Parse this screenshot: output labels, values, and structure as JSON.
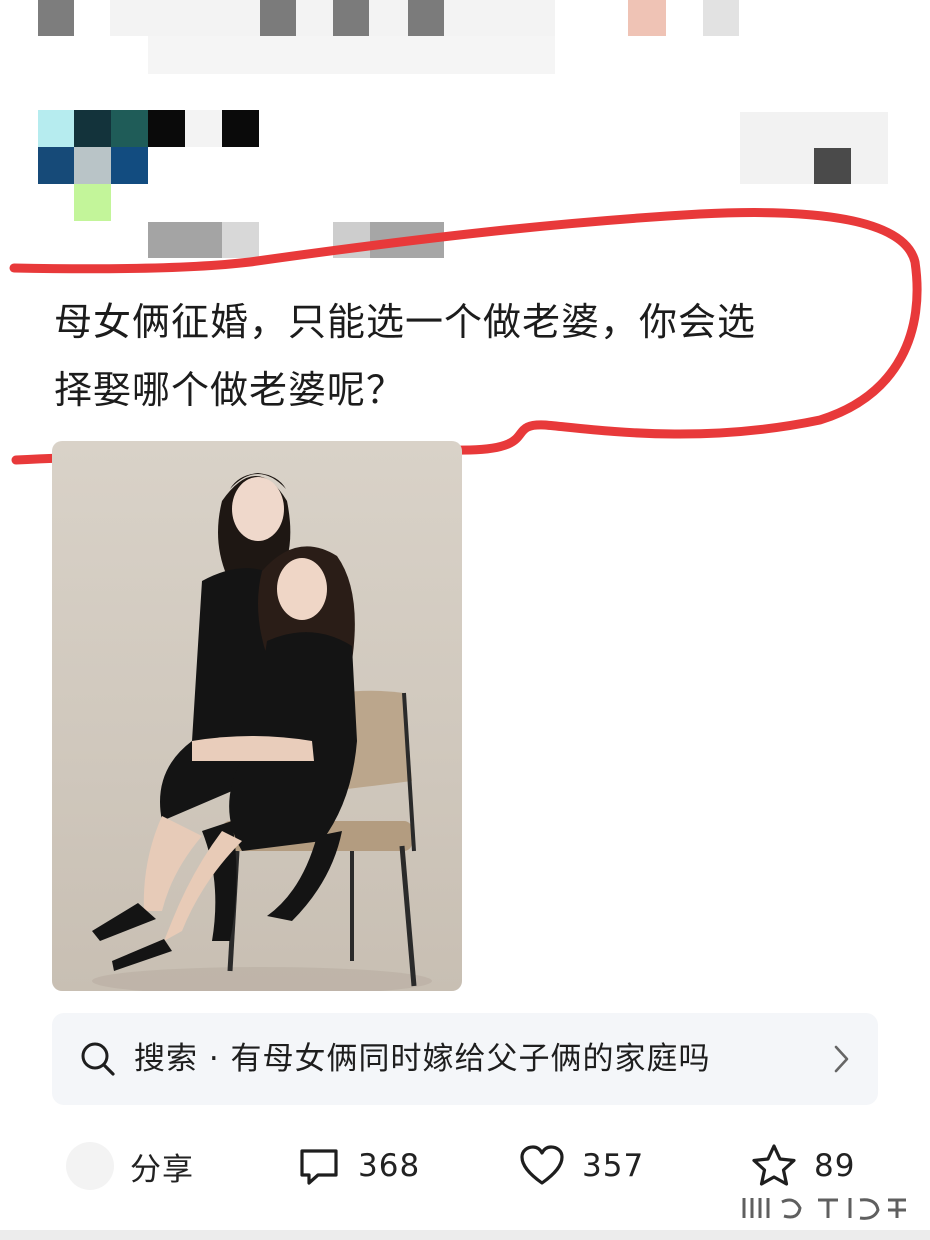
{
  "post": {
    "text_line1": "母女俩征婚，只能选一个做老婆，你会选",
    "text_line2": "择娶哪个做老婆呢？"
  },
  "search": {
    "text": "搜索 · 有母女俩同时嫁给父子俩的家庭吗",
    "icon": "search-icon",
    "chevron": "chevron-right-icon"
  },
  "actions": {
    "share_label": "分享",
    "comment_count": "368",
    "like_count": "357",
    "favorite_count": "89"
  },
  "colors": {
    "annotation_red": "#e8393a",
    "search_bg": "#f4f6f9",
    "text": "#1c1c1c"
  }
}
